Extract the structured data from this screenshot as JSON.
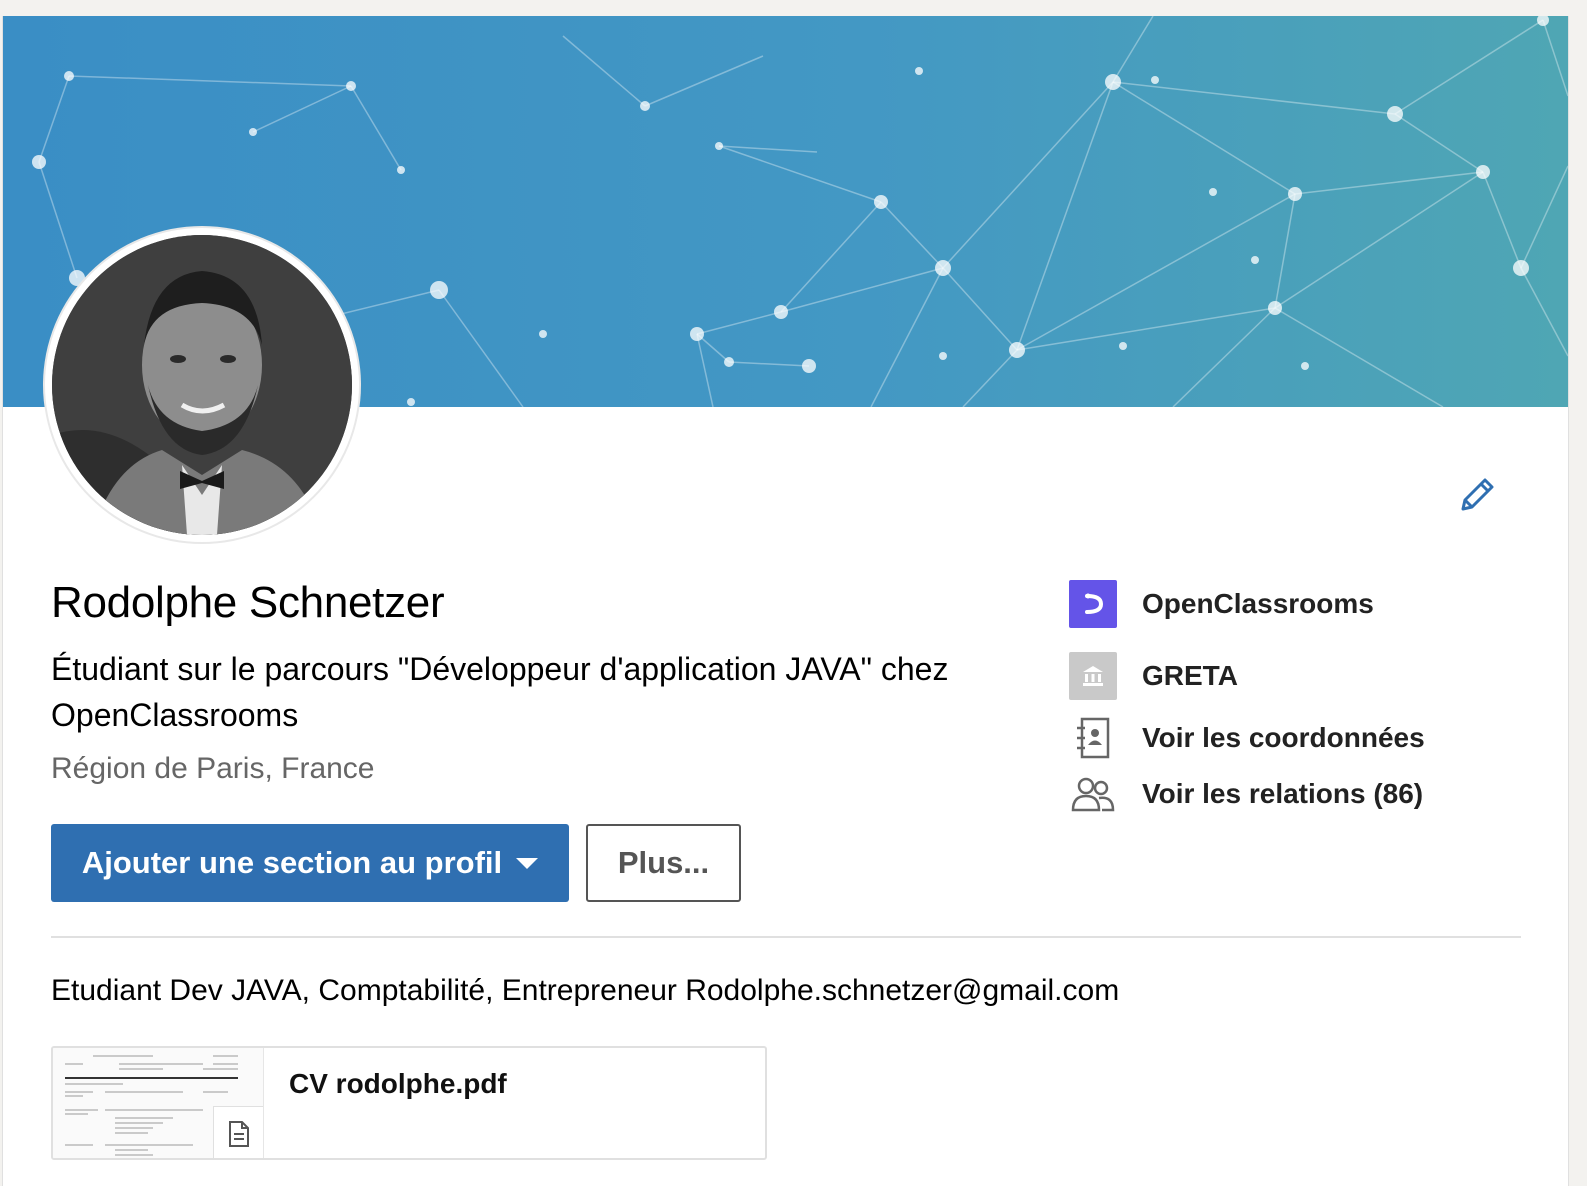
{
  "profile": {
    "name": "Rodolphe Schnetzer",
    "headline": "Étudiant sur le parcours \"Développeur d'application JAVA\" chez OpenClassrooms",
    "location": "Région de Paris, France"
  },
  "actions": {
    "add_section_label": "Ajouter une section au profil",
    "more_label": "Plus..."
  },
  "right_panel": {
    "items": [
      {
        "label": "OpenClassrooms",
        "icon": "openclassrooms-logo"
      },
      {
        "label": "GRETA",
        "icon": "school-icon"
      },
      {
        "label": "Voir les coordonnées",
        "icon": "contact-book-icon"
      },
      {
        "label": "Voir les relations (86)",
        "icon": "people-icon"
      }
    ]
  },
  "summary": "Etudiant Dev JAVA, Comptabilité, Entrepreneur Rodolphe.schnetzer@gmail.com",
  "document": {
    "title": "CV rodolphe.pdf",
    "icon": "document-icon"
  },
  "colors": {
    "primary": "#2f6fb1",
    "banner": "#4398c4",
    "openclassrooms": "#6454e8"
  }
}
